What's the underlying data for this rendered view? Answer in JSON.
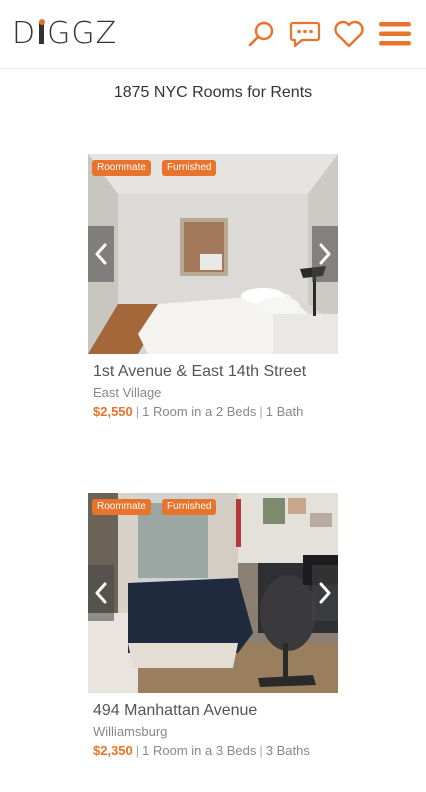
{
  "brand": {
    "logo_text_1": "D",
    "logo_text_2": "GGZ",
    "accent": "#e8732a"
  },
  "header": {
    "icons": [
      "search-icon",
      "chat-icon",
      "heart-icon",
      "menu-icon"
    ]
  },
  "page_title": "1875 NYC Rooms for Rents",
  "listings": [
    {
      "badges": [
        "Roommate",
        "Furnished"
      ],
      "street": "1st Avenue & East 14th Street",
      "neighborhood": "East Village",
      "price": "$2,550",
      "rooms": "1 Room in a 2 Beds",
      "baths": "1 Bath"
    },
    {
      "badges": [
        "Roommate",
        "Furnished"
      ],
      "street": "494 Manhattan Avenue",
      "neighborhood": "Williamsburg",
      "price": "$2,350",
      "rooms": "1 Room in a 3 Beds",
      "baths": "3 Baths"
    }
  ]
}
